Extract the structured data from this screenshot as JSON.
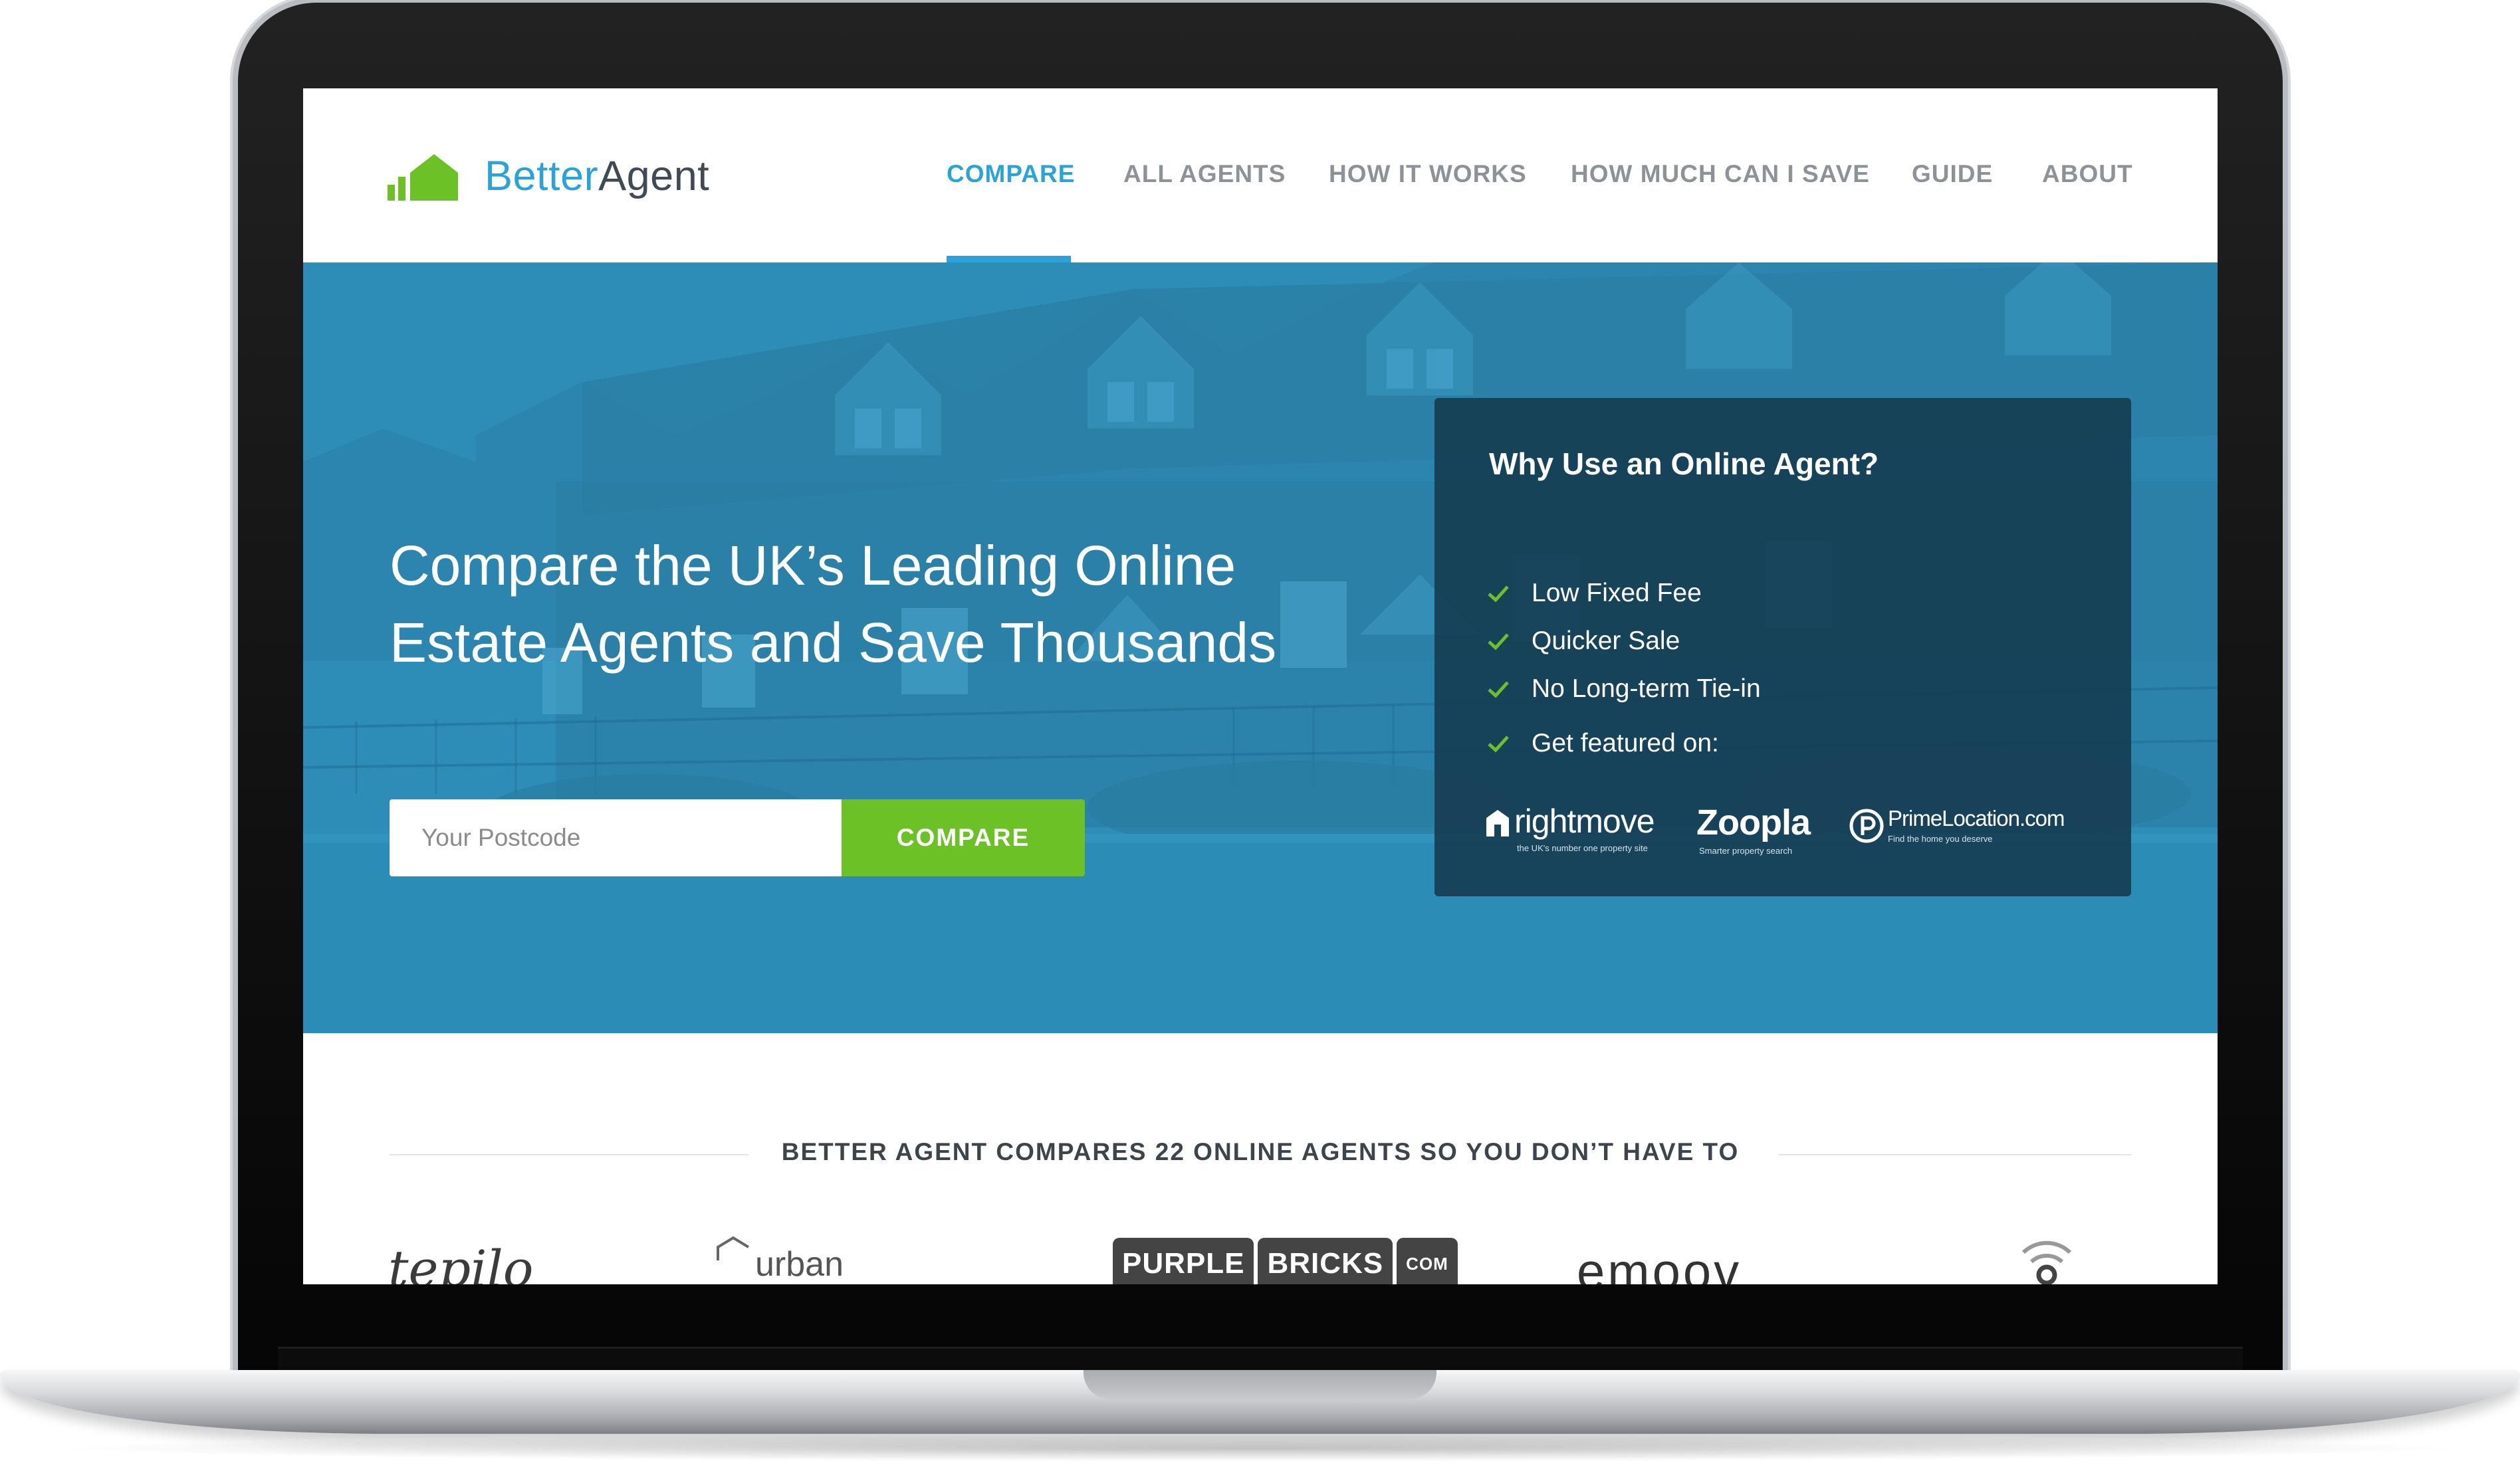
{
  "brand": {
    "name_part1": "Better",
    "name_part2": "Agent",
    "colors": {
      "blue": "#2ba3d8",
      "green": "#6cc127",
      "dark": "#3f4a55"
    }
  },
  "nav": {
    "items": [
      {
        "label": "COMPARE",
        "active": true
      },
      {
        "label": "ALL AGENTS",
        "active": false
      },
      {
        "label": "HOW IT WORKS",
        "active": false
      },
      {
        "label": "HOW MUCH CAN I SAVE",
        "active": false
      },
      {
        "label": "GUIDE",
        "active": false
      },
      {
        "label": "ABOUT",
        "active": false
      }
    ]
  },
  "hero": {
    "title_line1": "Compare the UK’s Leading Online",
    "title_line2": "Estate Agents and Save Thousands",
    "postcode_placeholder": "Your Postcode",
    "postcode_value": "",
    "compare_button": "COMPARE"
  },
  "panel": {
    "title": "Why Use an Online Agent?",
    "benefits": [
      "Low Fixed Fee",
      "Quicker Sale",
      "No Long-term Tie-in",
      "Get featured on:"
    ],
    "partners": [
      {
        "name": "rightmove",
        "tagline": "the UK's number one property site",
        "icon": "rightmove-logo-icon"
      },
      {
        "name": "Zoopla",
        "tagline": "Smarter property search",
        "icon": ""
      },
      {
        "name": "PrimeLocation.com",
        "tagline": "Find the home you deserve",
        "icon": "primelocation-logo-icon"
      }
    ]
  },
  "compare_strip": {
    "text": "BETTER AGENT COMPARES 22 ONLINE AGENTS SO YOU DON’T HAVE TO"
  },
  "agent_logos": {
    "tepilo": "tepilo",
    "urban": "urban",
    "purple_1": "PURPLE",
    "purple_2": "BRICKS",
    "purple_3": "COM",
    "emoov": "emoov"
  }
}
